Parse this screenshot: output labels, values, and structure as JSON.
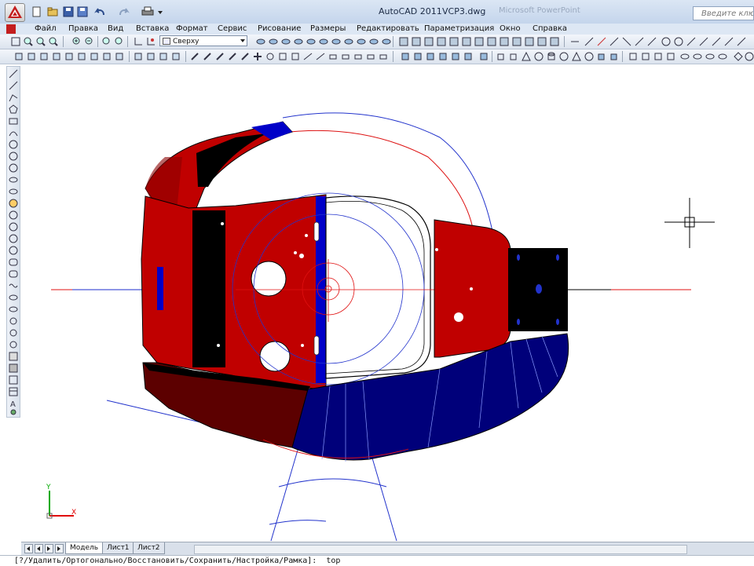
{
  "title": {
    "app": "AutoCAD 2011",
    "file": "VCP3.dwg",
    "ghost": "Microsoft PowerPoint"
  },
  "search": {
    "placeholder": "Введите ключе"
  },
  "menu": [
    "Файл",
    "Правка",
    "Вид",
    "Вставка",
    "Формат",
    "Сервис",
    "Рисование",
    "Размеры",
    "Редактировать",
    "Параметризация",
    "Окно",
    "Справка"
  ],
  "toolbar": {
    "view_dropdown": "Сверху"
  },
  "tabs": [
    "Модель",
    "Лист1",
    "Лист2"
  ],
  "ucs": {
    "y_label": "Y",
    "x_label": "X"
  },
  "command_line": "[?/Удалить/Ортогонально/Восстановить/Сохранить/Настройка/Рамка]:  top",
  "colors": {
    "red": "#c00000",
    "dark_red": "#600000",
    "blue": "#0000c8",
    "navy": "#00007a",
    "black": "#000000",
    "ucs_green": "#00aa00",
    "ucs_red": "#e00000"
  }
}
